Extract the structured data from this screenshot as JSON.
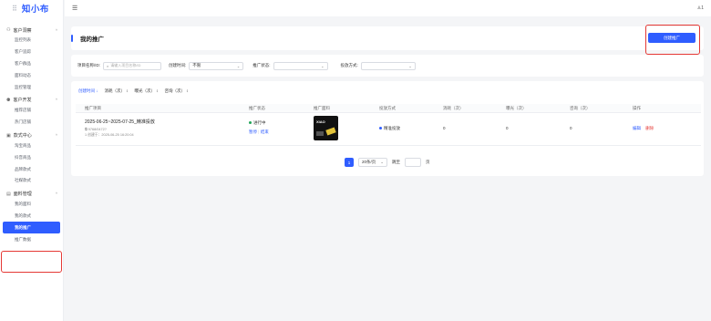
{
  "app": {
    "logo_text": "知小布",
    "user_label": "1"
  },
  "sidebar": {
    "groups": [
      {
        "label": "客户洞察",
        "items": [
          "监控列表",
          "客户追踪",
          "客户群品",
          "面料动态",
          "监控管理"
        ]
      },
      {
        "label": "客户开发",
        "items": [
          "推荐店铺",
          "热门店铺"
        ]
      },
      {
        "label": "款式中心",
        "items": [
          "淘宝商品",
          "抖音商品",
          "品牌款式",
          "社媒款式"
        ]
      },
      {
        "label": "面料管理",
        "items": [
          "我的面料",
          "我的款式",
          "我的推广",
          "推广数据"
        ]
      }
    ]
  },
  "page": {
    "title": "我的推广",
    "create_button": "创建推广"
  },
  "filters": {
    "id_label": "项目名称/ID:",
    "id_placeholder": "请输入项目名称/ID",
    "time_label": "创建时间:",
    "time_value": "不限",
    "status_label": "推广状态:",
    "status_value": "",
    "mode_label": "投放方式:",
    "mode_value": ""
  },
  "sort": [
    "创建时间 ↓",
    "消耗（次） ↕",
    "曝光（次） ↕",
    "咨询（次） ↕"
  ],
  "table": {
    "headers": [
      "推广项目",
      "推广状态",
      "推广面料",
      "投放方式",
      "消耗（次）",
      "曝光（次）",
      "咨询（次）",
      "操作"
    ],
    "rows": [
      {
        "name": "2025-06-25~2025-07-25_精准投放",
        "id": "9768/0472?",
        "created": "1 创建于：2025-06-25 16:20:04",
        "status": "进行中",
        "action1": "暂停",
        "action2": "结束",
        "thumb_text": "XIAO",
        "mode": "精准投放",
        "consume": "0",
        "exposure": "0",
        "consult": "0",
        "edit": "编辑",
        "delete": "删除"
      }
    ]
  },
  "pager": {
    "current": "1",
    "page_size": "20条/页",
    "goto_label": "跳至",
    "page_suffix": "页"
  },
  "colors": {
    "accent": "#2f5dff",
    "highlight": "#e53935"
  }
}
